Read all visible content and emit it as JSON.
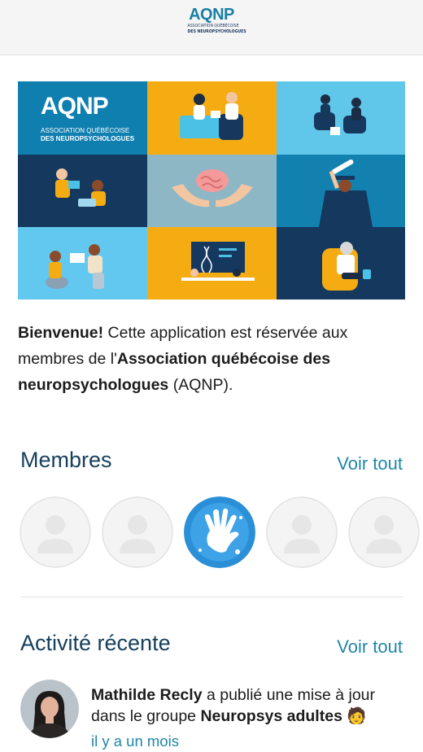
{
  "header": {
    "logo_word": "AQNP",
    "logo_sub1": "ASSOCIATION QUÉBÉCOISE",
    "logo_sub2": "DES NEUROPSYCHOLOGUES"
  },
  "hero": {
    "logo_word": "AQNP",
    "logo_sub1": "ASSOCIATION QUÉBÉCOISE",
    "logo_sub2": "DES NEUROPSYCHOLOGUES",
    "tile_colors": [
      "#0f7fb0",
      "#f5ac12",
      "#60c7ea",
      "#15385f",
      "#8eb7c6",
      "#1281b0",
      "#63c8ef",
      "#f5ac12",
      "#15385f"
    ]
  },
  "welcome": {
    "bold1": "Bienvenue!",
    "text1": " Cette application est réservée aux membres de l'",
    "bold2": "Association québécoise des neuropsychologues",
    "text2": " (AQNP)."
  },
  "members": {
    "title": "Membres",
    "see_all": "Voir tout"
  },
  "activity": {
    "title": "Activité récente",
    "see_all": "Voir tout",
    "item": {
      "user": "Mathilde Recly",
      "action": " a publié une mise à jour dans le groupe ",
      "group": "Neuropsys adultes",
      "emoji": "🧑",
      "time": "il y a un mois"
    }
  },
  "colors": {
    "accent": "#1f87a8",
    "title": "#16405c"
  }
}
